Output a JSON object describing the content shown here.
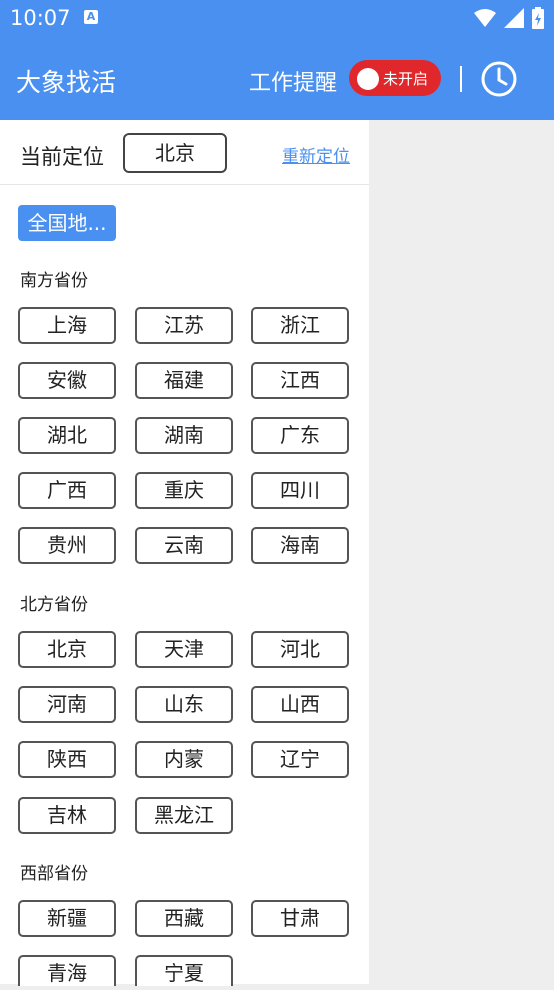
{
  "statusbar": {
    "time": "10:07",
    "a_icon": "A"
  },
  "appbar": {
    "title": "大象找活",
    "reminder_label": "工作提醒",
    "toggle_text": "未开启",
    "colors": {
      "primary": "#4a90f0",
      "toggle_off": "#e0282c"
    }
  },
  "location": {
    "label": "当前定位",
    "city": "北京",
    "relocate": "重新定位"
  },
  "all_chip": "全国地...",
  "sections": {
    "south": {
      "title": "南方省份",
      "items": [
        "上海",
        "江苏",
        "浙江",
        "安徽",
        "福建",
        "江西",
        "湖北",
        "湖南",
        "广东",
        "广西",
        "重庆",
        "四川",
        "贵州",
        "云南",
        "海南"
      ]
    },
    "north": {
      "title": "北方省份",
      "items": [
        "北京",
        "天津",
        "河北",
        "河南",
        "山东",
        "山西",
        "陕西",
        "内蒙",
        "辽宁",
        "吉林",
        "黑龙江"
      ]
    },
    "west": {
      "title": "西部省份",
      "items": [
        "新疆",
        "西藏",
        "甘肃",
        "青海",
        "宁夏"
      ]
    }
  }
}
